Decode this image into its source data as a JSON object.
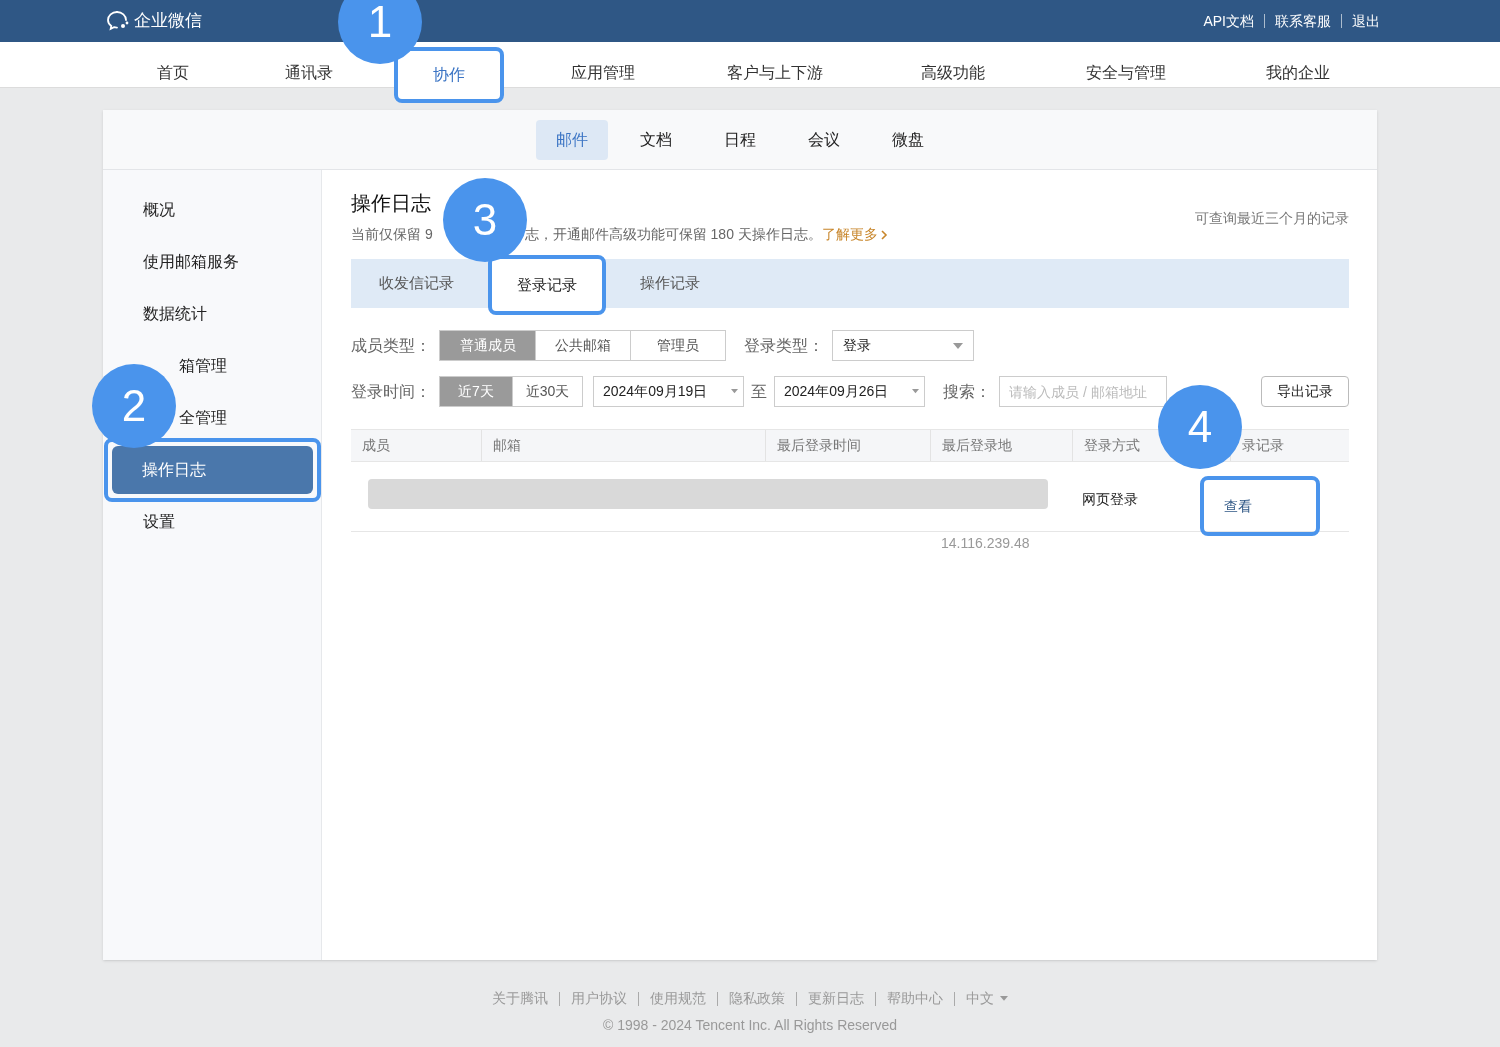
{
  "top_bar": {
    "logo": "企业微信",
    "links": [
      "API文档",
      "联系客服",
      "退出"
    ]
  },
  "nav": [
    {
      "label": "首页",
      "selected": false,
      "highlighted": false
    },
    {
      "label": "通讯录",
      "selected": false,
      "highlighted": false
    },
    {
      "label": "协作",
      "selected": true,
      "highlighted": true,
      "callout": "1"
    },
    {
      "label": "应用管理",
      "selected": false,
      "highlighted": false
    },
    {
      "label": "客户与上下游",
      "selected": false,
      "highlighted": false
    },
    {
      "label": "高级功能",
      "selected": false,
      "highlighted": false
    },
    {
      "label": "安全与管理",
      "selected": false,
      "highlighted": false
    },
    {
      "label": "我的企业",
      "selected": false,
      "highlighted": false
    }
  ],
  "app_tabs": [
    {
      "label": "邮件",
      "selected": true
    },
    {
      "label": "文档",
      "selected": false
    },
    {
      "label": "日程",
      "selected": false
    },
    {
      "label": "会议",
      "selected": false
    },
    {
      "label": "微盘",
      "selected": false
    }
  ],
  "sidebar": [
    {
      "label": "概况",
      "selected": false,
      "highlighted": false,
      "partly_hidden": false
    },
    {
      "label": "使用邮箱服务",
      "selected": false,
      "highlighted": false,
      "partly_hidden": false
    },
    {
      "label": "数据统计",
      "selected": false,
      "highlighted": false,
      "partly_hidden": false
    },
    {
      "label": "箱管理",
      "selected": false,
      "highlighted": false,
      "partly_hidden": true
    },
    {
      "label": "全管理",
      "selected": false,
      "highlighted": false,
      "partly_hidden": true
    },
    {
      "label": "操作日志",
      "selected": true,
      "highlighted": true,
      "callout": "2",
      "partly_hidden": false
    },
    {
      "label": "设置",
      "selected": false,
      "highlighted": false,
      "partly_hidden": false
    }
  ],
  "page": {
    "title": "操作日志",
    "notice_parts": [
      "当前仅保留 9",
      "志，开通邮件高级功能可保留 180 天操作日志。"
    ],
    "learn_more": "了解更多",
    "range_note": "可查询最近三个月的记录"
  },
  "log_tabs": [
    {
      "label": "收发信记录",
      "selected": false,
      "highlighted": false
    },
    {
      "label": "登录记录",
      "selected": true,
      "highlighted": true,
      "callout": "3"
    },
    {
      "label": "操作记录",
      "selected": false,
      "highlighted": false
    }
  ],
  "filters": {
    "member_type_label": "成员类型：",
    "member_types": [
      {
        "label": "普通成员",
        "selected": true
      },
      {
        "label": "公共邮箱",
        "selected": false
      },
      {
        "label": "管理员",
        "selected": false
      }
    ],
    "login_type_label": "登录类型：",
    "login_type": "登录",
    "time_label": "登录时间：",
    "ranges": [
      {
        "label": "近7天",
        "selected": true
      },
      {
        "label": "近30天",
        "selected": false
      }
    ],
    "date_from": "2024年09月19日",
    "to_label": "至",
    "date_to": "2024年09月26日",
    "search_label": "搜索：",
    "search_placeholder": "请输入成员 / 邮箱地址",
    "export_button": "导出记录"
  },
  "table": {
    "columns": [
      "成员",
      "邮箱",
      "最后登录时间",
      "最后登录地",
      "登录方式",
      "录记录"
    ],
    "rows": [
      {
        "login_place": "14.116.239.48",
        "login_method": "网页登录",
        "action": {
          "label": "查看",
          "highlighted": true,
          "callout": "4"
        }
      }
    ]
  },
  "footer": {
    "links": [
      "关于腾讯",
      "用户协议",
      "使用规范",
      "隐私政策",
      "更新日志",
      "帮助中心"
    ],
    "language": "中文",
    "copyright": "© 1998 - 2024 Tencent Inc. All Rights Reserved"
  }
}
